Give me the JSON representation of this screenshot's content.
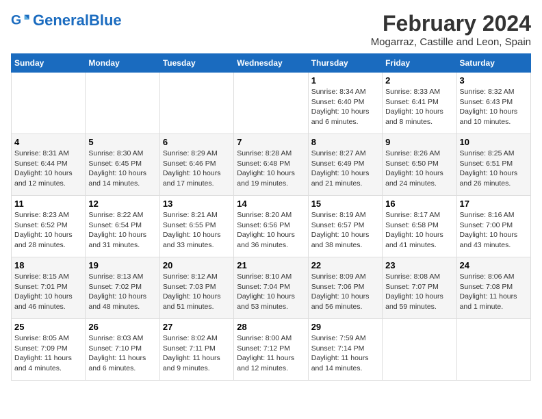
{
  "header": {
    "logo_general": "General",
    "logo_blue": "Blue",
    "title": "February 2024",
    "subtitle": "Mogarraz, Castille and Leon, Spain"
  },
  "calendar": {
    "days_of_week": [
      "Sunday",
      "Monday",
      "Tuesday",
      "Wednesday",
      "Thursday",
      "Friday",
      "Saturday"
    ],
    "weeks": [
      [
        {
          "day": "",
          "detail": ""
        },
        {
          "day": "",
          "detail": ""
        },
        {
          "day": "",
          "detail": ""
        },
        {
          "day": "",
          "detail": ""
        },
        {
          "day": "1",
          "detail": "Sunrise: 8:34 AM\nSunset: 6:40 PM\nDaylight: 10 hours\nand 6 minutes."
        },
        {
          "day": "2",
          "detail": "Sunrise: 8:33 AM\nSunset: 6:41 PM\nDaylight: 10 hours\nand 8 minutes."
        },
        {
          "day": "3",
          "detail": "Sunrise: 8:32 AM\nSunset: 6:43 PM\nDaylight: 10 hours\nand 10 minutes."
        }
      ],
      [
        {
          "day": "4",
          "detail": "Sunrise: 8:31 AM\nSunset: 6:44 PM\nDaylight: 10 hours\nand 12 minutes."
        },
        {
          "day": "5",
          "detail": "Sunrise: 8:30 AM\nSunset: 6:45 PM\nDaylight: 10 hours\nand 14 minutes."
        },
        {
          "day": "6",
          "detail": "Sunrise: 8:29 AM\nSunset: 6:46 PM\nDaylight: 10 hours\nand 17 minutes."
        },
        {
          "day": "7",
          "detail": "Sunrise: 8:28 AM\nSunset: 6:48 PM\nDaylight: 10 hours\nand 19 minutes."
        },
        {
          "day": "8",
          "detail": "Sunrise: 8:27 AM\nSunset: 6:49 PM\nDaylight: 10 hours\nand 21 minutes."
        },
        {
          "day": "9",
          "detail": "Sunrise: 8:26 AM\nSunset: 6:50 PM\nDaylight: 10 hours\nand 24 minutes."
        },
        {
          "day": "10",
          "detail": "Sunrise: 8:25 AM\nSunset: 6:51 PM\nDaylight: 10 hours\nand 26 minutes."
        }
      ],
      [
        {
          "day": "11",
          "detail": "Sunrise: 8:23 AM\nSunset: 6:52 PM\nDaylight: 10 hours\nand 28 minutes."
        },
        {
          "day": "12",
          "detail": "Sunrise: 8:22 AM\nSunset: 6:54 PM\nDaylight: 10 hours\nand 31 minutes."
        },
        {
          "day": "13",
          "detail": "Sunrise: 8:21 AM\nSunset: 6:55 PM\nDaylight: 10 hours\nand 33 minutes."
        },
        {
          "day": "14",
          "detail": "Sunrise: 8:20 AM\nSunset: 6:56 PM\nDaylight: 10 hours\nand 36 minutes."
        },
        {
          "day": "15",
          "detail": "Sunrise: 8:19 AM\nSunset: 6:57 PM\nDaylight: 10 hours\nand 38 minutes."
        },
        {
          "day": "16",
          "detail": "Sunrise: 8:17 AM\nSunset: 6:58 PM\nDaylight: 10 hours\nand 41 minutes."
        },
        {
          "day": "17",
          "detail": "Sunrise: 8:16 AM\nSunset: 7:00 PM\nDaylight: 10 hours\nand 43 minutes."
        }
      ],
      [
        {
          "day": "18",
          "detail": "Sunrise: 8:15 AM\nSunset: 7:01 PM\nDaylight: 10 hours\nand 46 minutes."
        },
        {
          "day": "19",
          "detail": "Sunrise: 8:13 AM\nSunset: 7:02 PM\nDaylight: 10 hours\nand 48 minutes."
        },
        {
          "day": "20",
          "detail": "Sunrise: 8:12 AM\nSunset: 7:03 PM\nDaylight: 10 hours\nand 51 minutes."
        },
        {
          "day": "21",
          "detail": "Sunrise: 8:10 AM\nSunset: 7:04 PM\nDaylight: 10 hours\nand 53 minutes."
        },
        {
          "day": "22",
          "detail": "Sunrise: 8:09 AM\nSunset: 7:06 PM\nDaylight: 10 hours\nand 56 minutes."
        },
        {
          "day": "23",
          "detail": "Sunrise: 8:08 AM\nSunset: 7:07 PM\nDaylight: 10 hours\nand 59 minutes."
        },
        {
          "day": "24",
          "detail": "Sunrise: 8:06 AM\nSunset: 7:08 PM\nDaylight: 11 hours\nand 1 minute."
        }
      ],
      [
        {
          "day": "25",
          "detail": "Sunrise: 8:05 AM\nSunset: 7:09 PM\nDaylight: 11 hours\nand 4 minutes."
        },
        {
          "day": "26",
          "detail": "Sunrise: 8:03 AM\nSunset: 7:10 PM\nDaylight: 11 hours\nand 6 minutes."
        },
        {
          "day": "27",
          "detail": "Sunrise: 8:02 AM\nSunset: 7:11 PM\nDaylight: 11 hours\nand 9 minutes."
        },
        {
          "day": "28",
          "detail": "Sunrise: 8:00 AM\nSunset: 7:12 PM\nDaylight: 11 hours\nand 12 minutes."
        },
        {
          "day": "29",
          "detail": "Sunrise: 7:59 AM\nSunset: 7:14 PM\nDaylight: 11 hours\nand 14 minutes."
        },
        {
          "day": "",
          "detail": ""
        },
        {
          "day": "",
          "detail": ""
        }
      ]
    ]
  }
}
